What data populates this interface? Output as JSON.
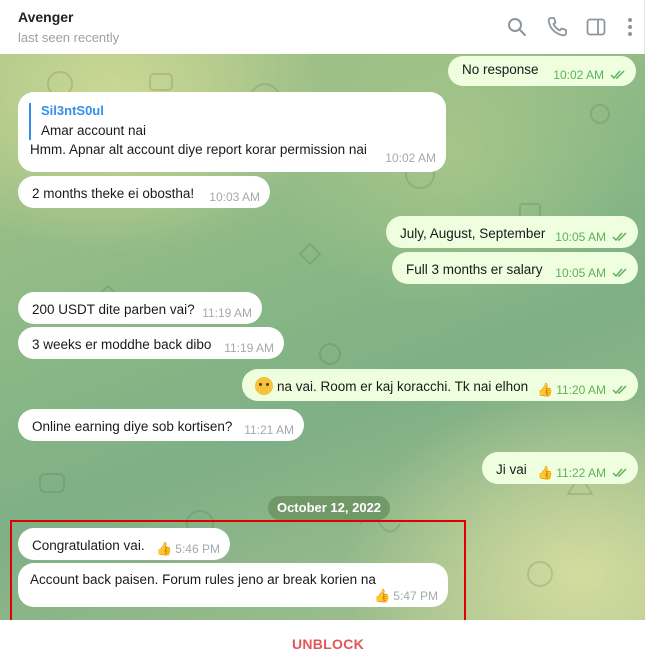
{
  "header": {
    "title": "Avenger",
    "subtitle": "last seen recently",
    "icons": [
      "search-icon",
      "phone-icon",
      "sidebar-toggle-icon",
      "more-vertical-icon"
    ]
  },
  "messages": [
    {
      "id": "m1",
      "direction": "out",
      "text": "No response",
      "time": "10:02 AM",
      "read": true
    },
    {
      "id": "m2",
      "direction": "in",
      "reply_to": {
        "name": "Sil3ntS0ul",
        "text": "Amar account nai"
      },
      "text": "Hmm. Apnar alt account diye report korar permission nai",
      "time": "10:02 AM"
    },
    {
      "id": "m3",
      "direction": "in",
      "text": "2 months theke ei obostha!",
      "time": "10:03 AM"
    },
    {
      "id": "m4",
      "direction": "out",
      "text": "July, August, September",
      "time": "10:05 AM",
      "read": true
    },
    {
      "id": "m5",
      "direction": "out",
      "text": "Full 3 months er salary",
      "time": "10:05 AM",
      "read": true
    },
    {
      "id": "m6",
      "direction": "in",
      "text": "200 USDT dite parben vai?",
      "time": "11:19 AM"
    },
    {
      "id": "m7",
      "direction": "in",
      "text": "3 weeks er moddhe back dibo",
      "time": "11:19 AM"
    },
    {
      "id": "m8",
      "direction": "out",
      "text": "na vai. Room er kaj koracchi. Tk nai elhon",
      "time": "11:20 AM",
      "reaction": "thumbs-up",
      "read": true
    },
    {
      "id": "m9",
      "direction": "in",
      "text": "Online earning diye sob kortisen?",
      "time": "11:21 AM"
    },
    {
      "id": "m10",
      "direction": "out",
      "text": "Ji vai",
      "time": "11:22 AM",
      "reaction": "thumbs-up",
      "read": true
    },
    {
      "id": "m11",
      "direction": "in",
      "text": "Congratulation vai.",
      "time": "5:46 PM",
      "reaction": "thumbs-up"
    },
    {
      "id": "m12",
      "direction": "in",
      "text": "Account back paisen. Forum rules jeno ar break korien na",
      "time": "5:47 PM",
      "reaction": "thumbs-up"
    }
  ],
  "date_separator": "October 12, 2022",
  "footer": {
    "action_label": "UNBLOCK"
  },
  "colors": {
    "accent": "#3390ec",
    "incoming_bubble": "#ffffff",
    "outgoing_bubble": "#eefedf",
    "read_check": "#5fb15a",
    "unblock": "#e0565b",
    "highlight_border": "#e00000"
  }
}
